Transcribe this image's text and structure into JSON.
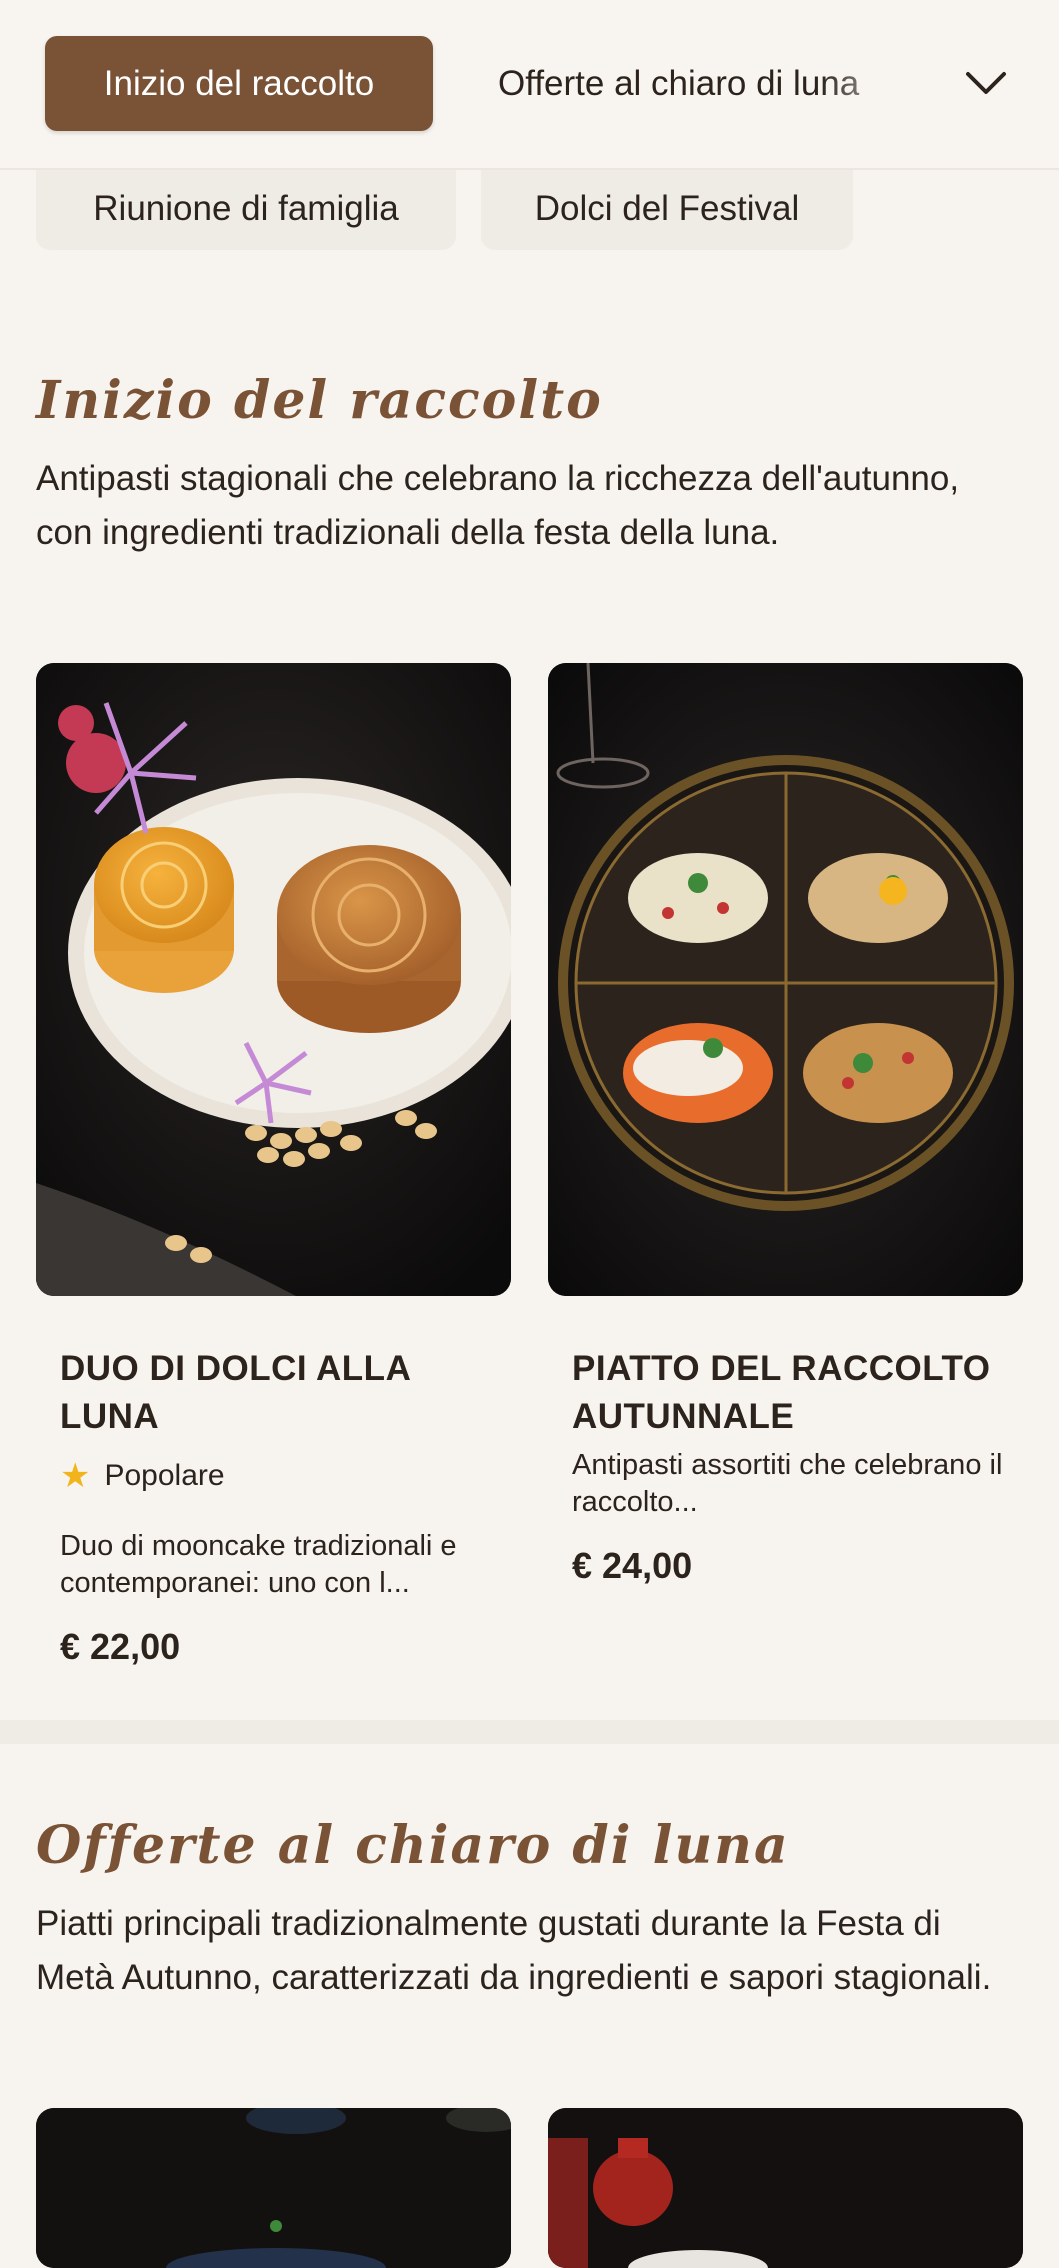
{
  "nav": {
    "active_tab": "Inizio del raccolto",
    "next_tab": "Offerte al chiaro di luna",
    "chips": [
      "Riunione di famiglia",
      "Dolci del Festival"
    ],
    "expand_icon": "chevron-down-icon"
  },
  "sections": [
    {
      "title": "Inizio del raccolto",
      "description": "Antipasti stagionali che celebrano la ricchezza dell'autunno, con ingredienti tradizionali della festa della luna.",
      "items": [
        {
          "name": "DUO DI DOLCI ALLA LUNA",
          "badge": "Popolare",
          "description": "Duo di mooncake tradizionali e contemporanei: uno con l...",
          "price": "€ 22,00"
        },
        {
          "name": "PIATTO DEL RACCOLTO AUTUNNALE",
          "description": "Antipasti assortiti che celebrano il raccolto...",
          "price": "€ 24,00"
        }
      ]
    },
    {
      "title": "Offerte al chiaro di luna",
      "description": "Piatti principali tradizionalmente gustati durante la Festa di Metà Autunno, caratterizzati da ingredienti e sapori stagionali."
    }
  ],
  "colors": {
    "accent": "#7a5236",
    "background": "#f7f4ef",
    "star": "#f2b41d"
  }
}
